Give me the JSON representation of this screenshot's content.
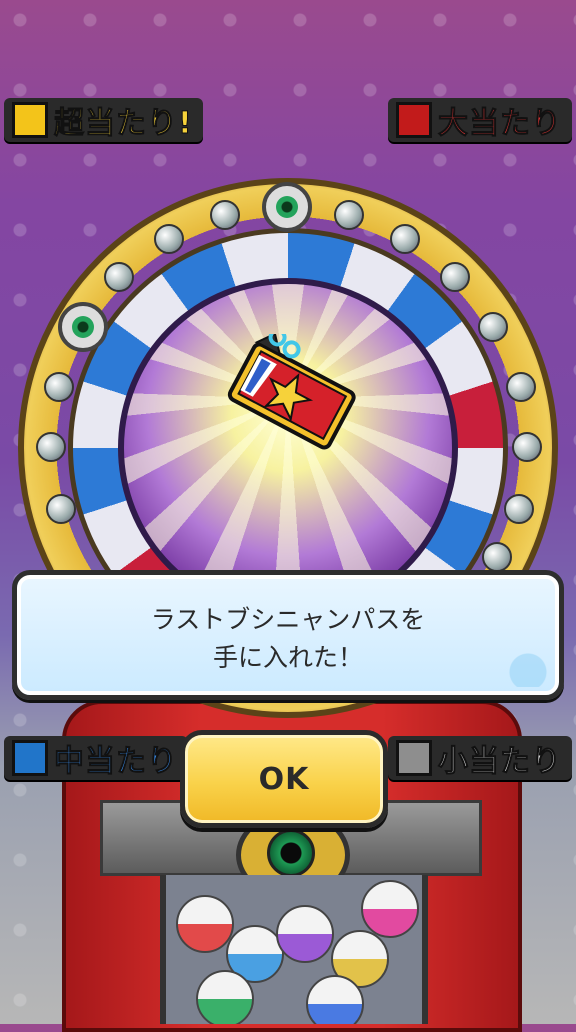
{
  "prize_labels": {
    "super": "超当たり!",
    "big": "大当たり",
    "mid": "中当たり",
    "small": "小当たり"
  },
  "dialog": {
    "message": "ラストブシニャンパスを\n手に入れた！"
  },
  "ok_button": {
    "label": "OK"
  },
  "item": {
    "icon": "ticket-pass-icon"
  },
  "colors": {
    "super": "#f3c41a",
    "big": "#c21b1b",
    "mid": "#2175c9",
    "small": "#8e8e8e",
    "ok_button": "#f9d24a"
  }
}
